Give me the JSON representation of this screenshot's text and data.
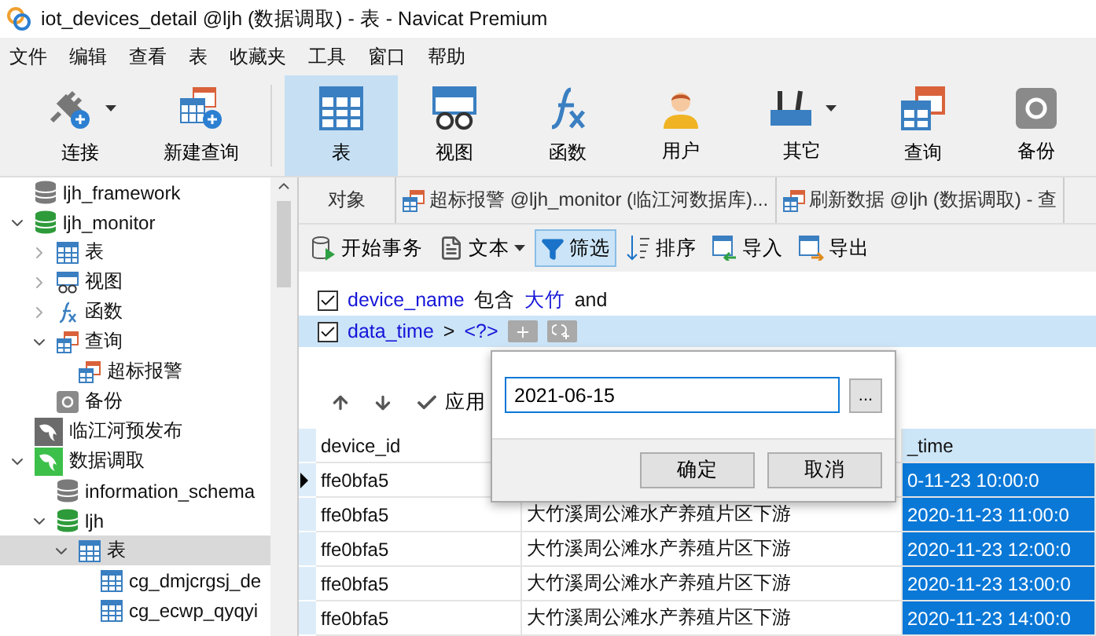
{
  "window": {
    "title": "iot_devices_detail @ljh (数据调取) - 表 - Navicat Premium"
  },
  "menu": [
    "文件",
    "编辑",
    "查看",
    "表",
    "收藏夹",
    "工具",
    "窗口",
    "帮助"
  ],
  "toolbar": [
    {
      "label": "连接",
      "kind": "connect",
      "dropdown": true,
      "selected": false
    },
    {
      "label": "新建查询",
      "kind": "newquery",
      "dropdown": false,
      "selected": false
    },
    {
      "label": "表",
      "kind": "table",
      "dropdown": false,
      "selected": true
    },
    {
      "label": "视图",
      "kind": "view",
      "dropdown": false,
      "selected": false
    },
    {
      "label": "函数",
      "kind": "function",
      "dropdown": false,
      "selected": false
    },
    {
      "label": "用户",
      "kind": "user",
      "dropdown": false,
      "selected": false
    },
    {
      "label": "其它",
      "kind": "tools",
      "dropdown": true,
      "selected": false
    },
    {
      "label": "查询",
      "kind": "query",
      "dropdown": false,
      "selected": false
    },
    {
      "label": "备份",
      "kind": "backup",
      "dropdown": false,
      "selected": false
    }
  ],
  "sidebar": {
    "items": [
      {
        "label": "ljh_framework",
        "kind": "database",
        "color": "#7a7a7a",
        "selected": false
      },
      {
        "label": "ljh_monitor",
        "kind": "database",
        "color": "#2e9b3a",
        "expanded": true,
        "selected": false,
        "children": [
          {
            "label": "表",
            "kind": "table",
            "expanded": false,
            "selected": false
          },
          {
            "label": "视图",
            "kind": "view",
            "expanded": false,
            "selected": false
          },
          {
            "label": "函数",
            "kind": "function",
            "expanded": false,
            "selected": false
          },
          {
            "label": "查询",
            "kind": "query",
            "expanded": true,
            "selected": false,
            "children": [
              {
                "label": "超标报警",
                "kind": "query",
                "selected": false
              }
            ]
          },
          {
            "label": "备份",
            "kind": "backup",
            "selected": false
          }
        ]
      },
      {
        "label": "临江河预发布",
        "kind": "connection",
        "color": "#6b6b6b",
        "selected": false
      },
      {
        "label": "数据调取",
        "kind": "connection",
        "color": "#3cc04a",
        "expanded": true,
        "selected": false,
        "children": [
          {
            "label": "information_schema",
            "kind": "database",
            "color": "#7a7a7a",
            "selected": false
          },
          {
            "label": "ljh",
            "kind": "database",
            "color": "#2e9b3a",
            "expanded": true,
            "selected": false,
            "children": [
              {
                "label": "表",
                "kind": "table",
                "expanded": true,
                "selected": true,
                "children": [
                  {
                    "label": "cg_dmjcrgsj_de",
                    "kind": "table",
                    "selected": false
                  },
                  {
                    "label": "cg_ecwp_qyqyi",
                    "kind": "table",
                    "selected": false
                  }
                ]
              }
            ]
          }
        ]
      }
    ]
  },
  "tabs": [
    {
      "label": "对象",
      "kind": "plain",
      "selected": false
    },
    {
      "label": "超标报警 @ljh_monitor (临江河数据库)...",
      "kind": "query",
      "selected": false
    },
    {
      "label": "刷新数据 @ljh (数据调取) - 查",
      "kind": "query",
      "selected": false
    }
  ],
  "data_toolbar": [
    {
      "label": "开始事务",
      "kind": "transaction",
      "selected": false
    },
    {
      "label": "文本",
      "kind": "text",
      "selected": false,
      "dropdown": true
    },
    {
      "label": "筛选",
      "kind": "filter",
      "selected": true
    },
    {
      "label": "排序",
      "kind": "sort",
      "selected": false
    },
    {
      "label": "导入",
      "kind": "import",
      "selected": false
    },
    {
      "label": "导出",
      "kind": "export",
      "selected": false
    }
  ],
  "filters": [
    {
      "checked": true,
      "field": "device_name",
      "operator": "包含",
      "value": "大竹",
      "conjunction": "and",
      "selected": false
    },
    {
      "checked": true,
      "field": "data_time",
      "operator": ">",
      "value": "<?>",
      "selected": true
    }
  ],
  "apply_button": "应用",
  "popup": {
    "value": "2021-06-15",
    "browse": "...",
    "ok": "确定",
    "cancel": "取消"
  },
  "table": {
    "columns": [
      "device_id",
      "",
      "_time"
    ],
    "rows": [
      {
        "selected": true,
        "cells": [
          "ffe0bfa5",
          "",
          "0-11-23 10:00:0"
        ]
      },
      {
        "selected": false,
        "cells": [
          "ffe0bfa5",
          "大竹溪周公滩水产养殖片区下游",
          "2020-11-23 11:00:0"
        ]
      },
      {
        "selected": false,
        "cells": [
          "ffe0bfa5",
          "大竹溪周公滩水产养殖片区下游",
          "2020-11-23 12:00:0"
        ]
      },
      {
        "selected": false,
        "cells": [
          "ffe0bfa5",
          "大竹溪周公滩水产养殖片区下游",
          "2020-11-23 13:00:0"
        ]
      },
      {
        "selected": false,
        "cells": [
          "ffe0bfa5",
          "大竹溪周公滩水产养殖片区下游",
          "2020-11-23 14:00:0"
        ]
      }
    ]
  }
}
